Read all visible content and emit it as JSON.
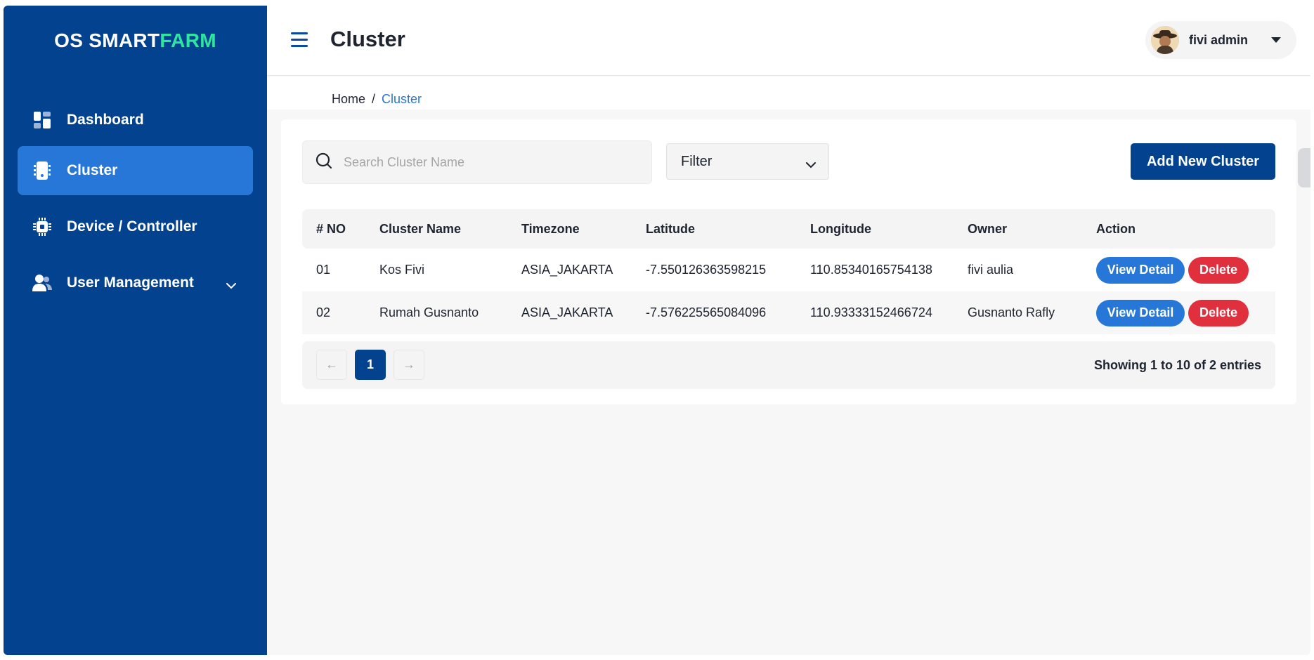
{
  "brand": {
    "prefix": "OS SMART",
    "accent": "FARM",
    "accent_color": "#2ee6a0",
    "primary_color": "#03428f"
  },
  "sidebar": {
    "items": [
      {
        "label": "Dashboard",
        "icon": "dashboard-icon",
        "active": false
      },
      {
        "label": "Cluster",
        "icon": "cluster-icon",
        "active": true
      },
      {
        "label": "Device / Controller",
        "icon": "chip-icon",
        "active": false
      },
      {
        "label": "User Management",
        "icon": "users-icon",
        "active": false,
        "expandable": true
      }
    ]
  },
  "header": {
    "title": "Cluster",
    "user": "fivi admin"
  },
  "breadcrumb": {
    "home": "Home",
    "separator": "/",
    "current": "Cluster"
  },
  "toolbar": {
    "search_placeholder": "Search Cluster Name",
    "filter_label": "Filter",
    "add_button": "Add New Cluster"
  },
  "table": {
    "headers": [
      "# NO",
      "Cluster Name",
      "Timezone",
      "Latitude",
      "Longitude",
      "Owner",
      "Action"
    ],
    "rows": [
      {
        "no": "01",
        "name": "Kos Fivi",
        "timezone": "ASIA_JAKARTA",
        "latitude": "-7.550126363598215",
        "longitude": "110.85340165754138",
        "owner": "fivi aulia"
      },
      {
        "no": "02",
        "name": "Rumah Gusnanto",
        "timezone": "ASIA_JAKARTA",
        "latitude": "-7.576225565084096",
        "longitude": "110.93333152466724",
        "owner": "Gusnanto Rafly"
      }
    ],
    "view_label": "View Detail",
    "delete_label": "Delete"
  },
  "pagination": {
    "prev": "←",
    "current_page": "1",
    "next": "→",
    "summary": "Showing 1 to 10 of 2 entries"
  }
}
